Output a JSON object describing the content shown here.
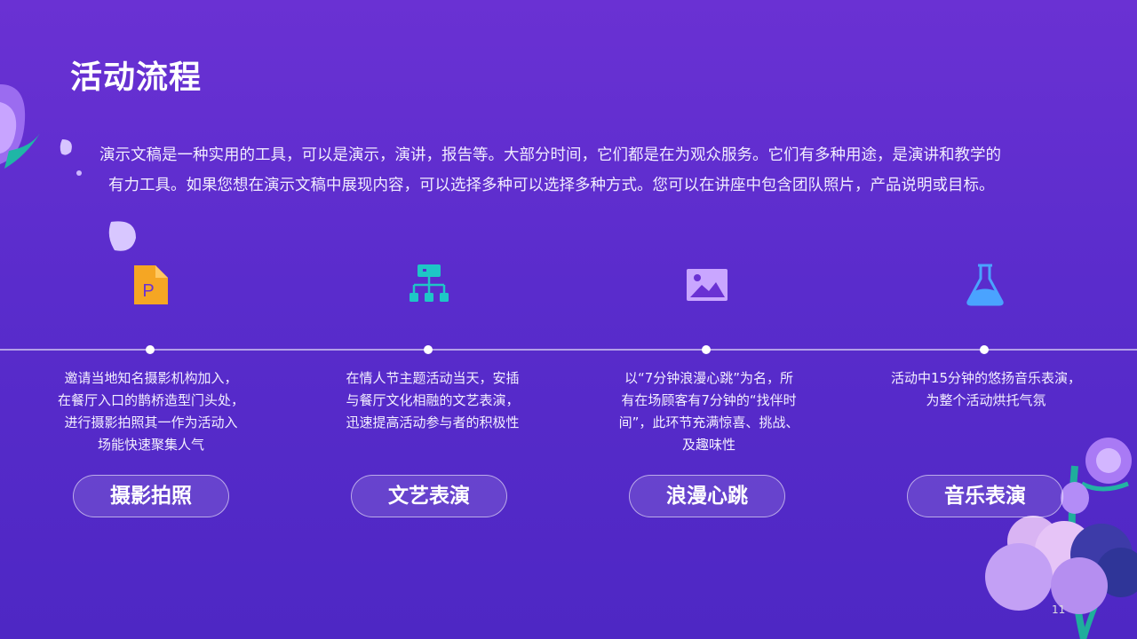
{
  "title": "活动流程",
  "intro": {
    "line1": "演示文稿是一种实用的工具，可以是演示，演讲，报告等。大部分时间，它们都是在为观众服务。它们有多种用途，是演讲和教学的",
    "line2": "有力工具。如果您想在演示文稿中展现内容，可以选择多种可以选择多种方式。您可以在讲座中包含团队照片，产品说明或目标。"
  },
  "steps": [
    {
      "icon": "file-p-icon",
      "icon_color": "#f5a623",
      "desc": [
        "邀请当地知名摄影机构加入，",
        "在餐厅入口的鹊桥造型门头处，",
        "进行摄影拍照其一作为活动入",
        "场能快速聚集人气"
      ],
      "label": "摄影拍照"
    },
    {
      "icon": "org-chart-icon",
      "icon_color": "#1ec6c6",
      "desc": [
        "在情人节主题活动当天，安插",
        "与餐厅文化相融的文艺表演，",
        "迅速提高活动参与者的积极性"
      ],
      "label": "文艺表演"
    },
    {
      "icon": "image-icon",
      "icon_color": "#c9a6ff",
      "desc": [
        "以“7分钟浪漫心跳”为名，所",
        "有在场顾客有7分钟的“找伴时",
        "间”，此环节充满惊喜、挑战、",
        "及趣味性"
      ],
      "label": "浪漫心跳"
    },
    {
      "icon": "flask-icon",
      "icon_color": "#4aa3ff",
      "desc": [
        "活动中15分钟的悠扬音乐表演，",
        "为整个活动烘托气氛"
      ],
      "label": "音乐表演"
    }
  ],
  "page_number": "11"
}
